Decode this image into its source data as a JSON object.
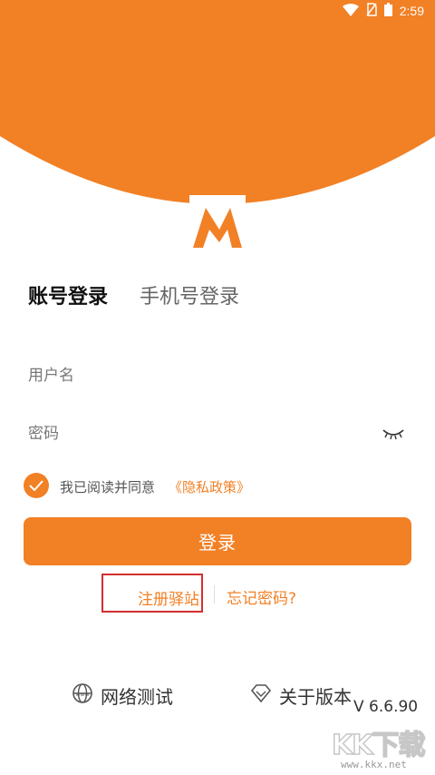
{
  "colors": {
    "accent": "#f28025",
    "header": "#f28025",
    "highlight_box": "#d32f2f"
  },
  "status_bar": {
    "time": "2:59",
    "icons": [
      "wifi-icon",
      "no-sim-icon",
      "battery-icon"
    ]
  },
  "logo": {
    "letter": "M"
  },
  "tabs": [
    {
      "label": "账号登录",
      "active": true
    },
    {
      "label": "手机号登录",
      "active": false
    }
  ],
  "form": {
    "username_placeholder": "用户名",
    "password_placeholder": "密码",
    "agreement_text": "我已阅读并同意",
    "privacy_link": "《隐私政策》",
    "agreement_checked": true,
    "login_label": "登录"
  },
  "links": {
    "register": "注册驿站",
    "forgot": "忘记密码?"
  },
  "footer": {
    "network_test": "网络测试",
    "about_version": "关于版本",
    "version": "V 6.6.90"
  },
  "watermark": {
    "main": "KK下载",
    "url": "www.kkx.net"
  }
}
